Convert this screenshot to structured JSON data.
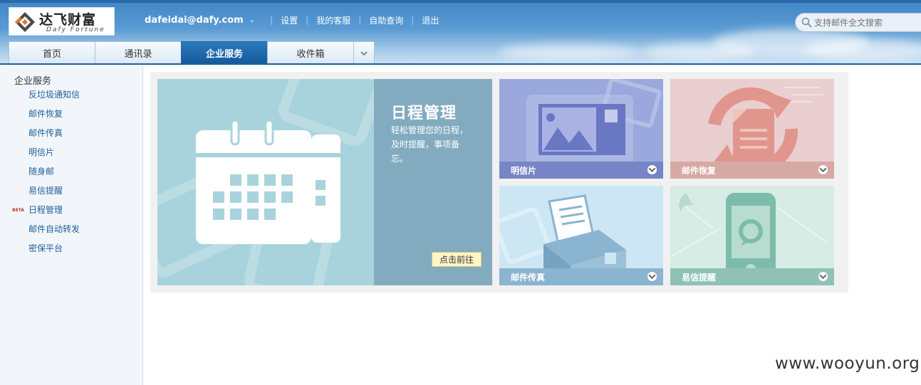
{
  "header": {
    "logo_cn": "达飞财富",
    "logo_en": "Dafy Fortune",
    "user_email": "dafeidai@dafy.com",
    "links": [
      "设置",
      "我的客服",
      "自助查询",
      "退出"
    ],
    "search_placeholder": "支持邮件全文搜索"
  },
  "tabs": [
    {
      "label": "首页",
      "active": false
    },
    {
      "label": "通讯录",
      "active": false
    },
    {
      "label": "企业服务",
      "active": true
    },
    {
      "label": "收件箱",
      "active": false
    }
  ],
  "sidebar": {
    "title": "企业服务",
    "items": [
      {
        "label": "反垃圾通知信"
      },
      {
        "label": "邮件恢复"
      },
      {
        "label": "邮件传真"
      },
      {
        "label": "明信片"
      },
      {
        "label": "随身邮"
      },
      {
        "label": "易信提醒"
      },
      {
        "label": "日程管理",
        "badge": "BETA"
      },
      {
        "label": "邮件自动转发"
      },
      {
        "label": "密保平台"
      }
    ]
  },
  "hero": {
    "title": "日程管理",
    "description": "轻松管理您的日程，及时提醒，事项备忘。",
    "button": "点击前往"
  },
  "tiles": [
    {
      "label": "明信片",
      "icon": "postcard-icon"
    },
    {
      "label": "邮件恢复",
      "icon": "mail-recovery-icon"
    },
    {
      "label": "邮件传真",
      "icon": "fax-icon"
    },
    {
      "label": "易信提醒",
      "icon": "phone-reminder-icon"
    }
  ],
  "watermark": "www.wooyun.org",
  "colors": {
    "header_blue": "#3f86c6",
    "active_tab": "#135a9c",
    "sidebar_link": "#1f5f9d",
    "hero_bg": "#a8d3dc"
  }
}
